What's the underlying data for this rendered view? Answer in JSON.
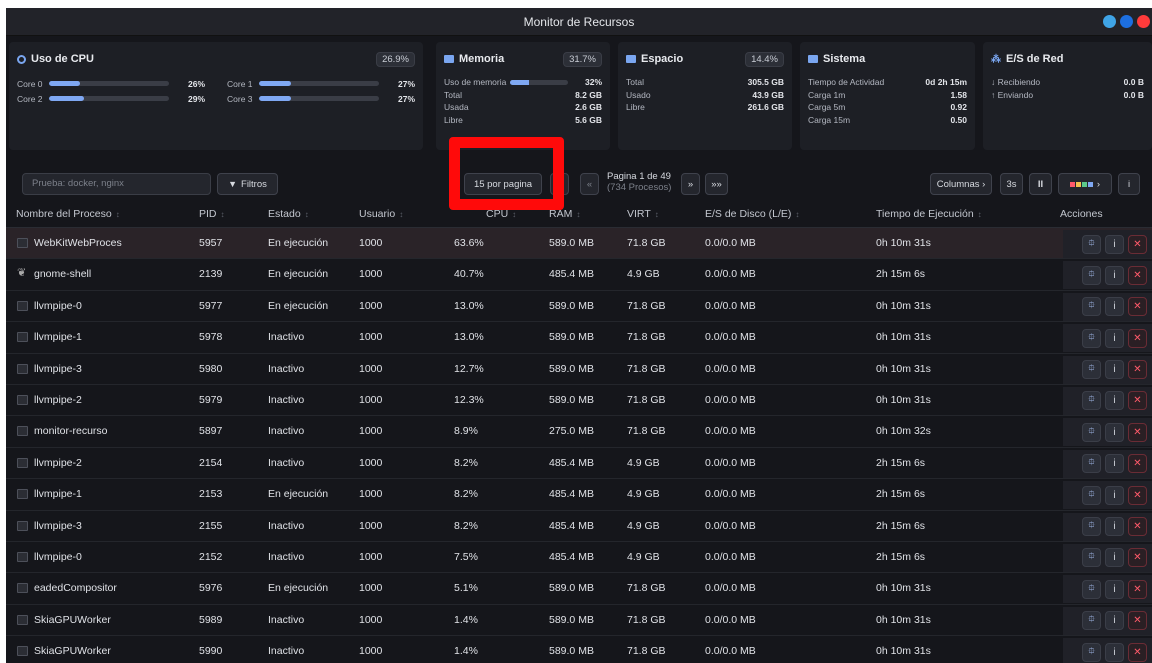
{
  "window": {
    "title": "Monitor de Recursos",
    "dot_colors": [
      "#3fa4e6",
      "#1d6fe0",
      "#ff3b3b"
    ]
  },
  "cpu": {
    "title": "Uso de CPU",
    "percent": "26.9%",
    "cores": [
      {
        "label": "Core 0",
        "value": "26%",
        "level": 0.26
      },
      {
        "label": "Core 1",
        "value": "27%",
        "level": 0.27
      },
      {
        "label": "Core 2",
        "value": "29%",
        "level": 0.29
      },
      {
        "label": "Core 3",
        "value": "27%",
        "level": 0.27
      }
    ]
  },
  "memory": {
    "title": "Memoria",
    "percent": "31.7%",
    "usage_label": "Uso de memoria",
    "usage_value": "32%",
    "usage_level": 0.32,
    "rows": [
      {
        "label": "Total",
        "value": "8.2 GB"
      },
      {
        "label": "Usada",
        "value": "2.6 GB"
      },
      {
        "label": "Libre",
        "value": "5.6 GB"
      }
    ]
  },
  "disk": {
    "title": "Espacio",
    "percent": "14.4%",
    "rows": [
      {
        "label": "Total",
        "value": "305.5 GB"
      },
      {
        "label": "Usado",
        "value": "43.9 GB"
      },
      {
        "label": "Libre",
        "value": "261.6 GB"
      }
    ]
  },
  "system": {
    "title": "Sistema",
    "rows": [
      {
        "label": "Tiempo de Actividad",
        "value": "0d 2h 15m"
      },
      {
        "label": "Carga 1m",
        "value": "1.58"
      },
      {
        "label": "Carga 5m",
        "value": "0.92"
      },
      {
        "label": "Carga 15m",
        "value": "0.50"
      }
    ]
  },
  "network": {
    "title": "E/S de Red",
    "rows": [
      {
        "label": "↓ Recibiendo",
        "value": "0.0 B"
      },
      {
        "label": "↑ Enviando",
        "value": "0.0 B"
      }
    ]
  },
  "toolbar": {
    "search_placeholder": "Prueba: docker, nginx",
    "filters": "Filtros",
    "per_page": "15 por pagina",
    "prev": "‹",
    "first": "«",
    "page": "Pagina 1 de 49",
    "processes": "(734 Procesos)",
    "next": "»",
    "last": "»»",
    "columns": "Columnas ›",
    "interval": "3s",
    "pause": "II",
    "view": "›",
    "info": "i"
  },
  "columns": {
    "name": "Nombre del Proceso",
    "pid": "PID",
    "state": "Estado",
    "user": "Usuario",
    "cpu": "CPU",
    "ram": "RAM",
    "virt": "VIRT",
    "io": "E/S de Disco (L/E)",
    "time": "Tiempo de Ejecución",
    "actions": "Acciones",
    "sort_glyph": "↕"
  },
  "processes": [
    {
      "name": "WebKitWebProces",
      "pid": "5957",
      "state": "En ejecución",
      "user": "1000",
      "cpu": "63.6%",
      "ram": "589.0 MB",
      "virt": "71.8 GB",
      "io": "0.0/0.0 MB",
      "time": "0h 10m 31s"
    },
    {
      "name": "gnome-shell",
      "pid": "2139",
      "state": "En ejecución",
      "user": "1000",
      "cpu": "40.7%",
      "ram": "485.4 MB",
      "virt": "4.9 GB",
      "io": "0.0/0.0 MB",
      "time": "2h 15m 6s"
    },
    {
      "name": "llvmpipe-0",
      "pid": "5977",
      "state": "En ejecución",
      "user": "1000",
      "cpu": "13.0%",
      "ram": "589.0 MB",
      "virt": "71.8 GB",
      "io": "0.0/0.0 MB",
      "time": "0h 10m 31s"
    },
    {
      "name": "llvmpipe-1",
      "pid": "5978",
      "state": "Inactivo",
      "user": "1000",
      "cpu": "13.0%",
      "ram": "589.0 MB",
      "virt": "71.8 GB",
      "io": "0.0/0.0 MB",
      "time": "0h 10m 31s"
    },
    {
      "name": "llvmpipe-3",
      "pid": "5980",
      "state": "Inactivo",
      "user": "1000",
      "cpu": "12.7%",
      "ram": "589.0 MB",
      "virt": "71.8 GB",
      "io": "0.0/0.0 MB",
      "time": "0h 10m 31s"
    },
    {
      "name": "llvmpipe-2",
      "pid": "5979",
      "state": "Inactivo",
      "user": "1000",
      "cpu": "12.3%",
      "ram": "589.0 MB",
      "virt": "71.8 GB",
      "io": "0.0/0.0 MB",
      "time": "0h 10m 31s"
    },
    {
      "name": "monitor-recurso",
      "pid": "5897",
      "state": "Inactivo",
      "user": "1000",
      "cpu": "8.9%",
      "ram": "275.0 MB",
      "virt": "71.8 GB",
      "io": "0.0/0.0 MB",
      "time": "0h 10m 32s"
    },
    {
      "name": "llvmpipe-2",
      "pid": "2154",
      "state": "Inactivo",
      "user": "1000",
      "cpu": "8.2%",
      "ram": "485.4 MB",
      "virt": "4.9 GB",
      "io": "0.0/0.0 MB",
      "time": "2h 15m 6s"
    },
    {
      "name": "llvmpipe-1",
      "pid": "2153",
      "state": "En ejecución",
      "user": "1000",
      "cpu": "8.2%",
      "ram": "485.4 MB",
      "virt": "4.9 GB",
      "io": "0.0/0.0 MB",
      "time": "2h 15m 6s"
    },
    {
      "name": "llvmpipe-3",
      "pid": "2155",
      "state": "Inactivo",
      "user": "1000",
      "cpu": "8.2%",
      "ram": "485.4 MB",
      "virt": "4.9 GB",
      "io": "0.0/0.0 MB",
      "time": "2h 15m 6s"
    },
    {
      "name": "llvmpipe-0",
      "pid": "2152",
      "state": "Inactivo",
      "user": "1000",
      "cpu": "7.5%",
      "ram": "485.4 MB",
      "virt": "4.9 GB",
      "io": "0.0/0.0 MB",
      "time": "2h 15m 6s"
    },
    {
      "name": "eadedCompositor",
      "pid": "5976",
      "state": "En ejecución",
      "user": "1000",
      "cpu": "5.1%",
      "ram": "589.0 MB",
      "virt": "71.8 GB",
      "io": "0.0/0.0 MB",
      "time": "0h 10m 31s"
    },
    {
      "name": "SkiaGPUWorker",
      "pid": "5989",
      "state": "Inactivo",
      "user": "1000",
      "cpu": "1.4%",
      "ram": "589.0 MB",
      "virt": "71.8 GB",
      "io": "0.0/0.0 MB",
      "time": "0h 10m 31s"
    },
    {
      "name": "SkiaGPUWorker",
      "pid": "5990",
      "state": "Inactivo",
      "user": "1000",
      "cpu": "1.4%",
      "ram": "589.0 MB",
      "virt": "71.8 GB",
      "io": "0.0/0.0 MB",
      "time": "0h 10m 31s"
    }
  ],
  "row_actions": {
    "pin": "⯐",
    "info": "i",
    "kill": "✕"
  },
  "colors": {
    "accent": "#7fa8f3",
    "highlight": "#ff0a0a",
    "kill": "#ff5a6a",
    "selected_row": "#2a2328"
  }
}
